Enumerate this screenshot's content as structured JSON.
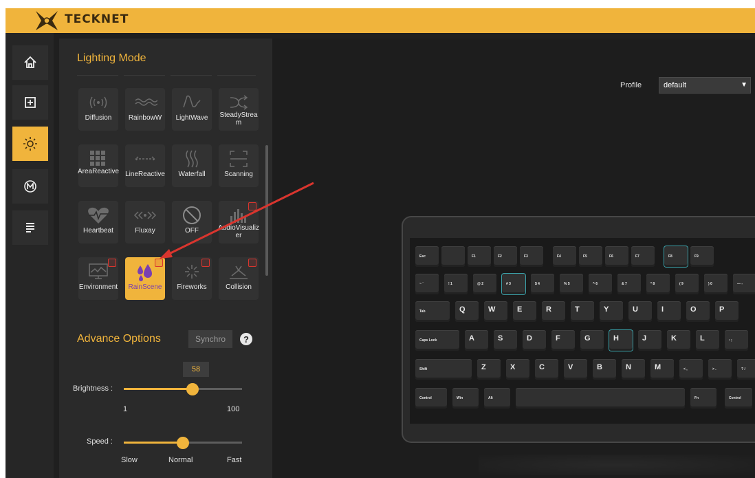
{
  "brand": "TECKNET",
  "rail": {
    "items": [
      {
        "icon": "home-icon",
        "active": false
      },
      {
        "icon": "plus-square-icon",
        "active": false
      },
      {
        "icon": "sun-lighting-icon",
        "active": true
      },
      {
        "icon": "macro-m-icon",
        "active": false
      },
      {
        "icon": "document-lines-icon",
        "active": false
      }
    ]
  },
  "lighting": {
    "title": "Lighting Mode",
    "modes": [
      {
        "label": "Diffusion",
        "icon": "diffusion-icon"
      },
      {
        "label": "RainbowW",
        "icon": "rainbow-wave-icon"
      },
      {
        "label": "LightWave",
        "icon": "light-wave-icon"
      },
      {
        "label": "SteadyStream",
        "icon": "steady-stream-icon"
      },
      {
        "label": "AreaReactive",
        "icon": "area-reactive-icon"
      },
      {
        "label": "LineReactive",
        "icon": "line-reactive-icon"
      },
      {
        "label": "Waterfall",
        "icon": "waterfall-icon"
      },
      {
        "label": "Scanning",
        "icon": "scanning-icon"
      },
      {
        "label": "Heartbeat",
        "icon": "heartbeat-icon"
      },
      {
        "label": "Fluxay",
        "icon": "fluxay-icon"
      },
      {
        "label": "OFF",
        "icon": "off-icon"
      },
      {
        "label": "AudioVisualizer",
        "icon": "audio-visualizer-icon"
      },
      {
        "label": "Environment",
        "icon": "environment-icon"
      },
      {
        "label": "RainScene",
        "icon": "rain-scene-icon",
        "active": true
      },
      {
        "label": "Fireworks",
        "icon": "fireworks-icon"
      },
      {
        "label": "Collision",
        "icon": "collision-icon"
      }
    ]
  },
  "advance": {
    "title": "Advance Options",
    "synchro": "Synchro",
    "help": "?",
    "brightness": {
      "label": "Brightness :",
      "value": "58",
      "min": "1",
      "max": "100",
      "level": 0.58
    },
    "speed": {
      "label": "Speed :",
      "slow": "Slow",
      "normal": "Normal",
      "fast": "Fast",
      "level": 0.5
    }
  },
  "profile": {
    "label": "Profile",
    "value": "default"
  },
  "keyboard": {
    "row0": [
      "Esc",
      "",
      "F1",
      "F2",
      "F3",
      "F4",
      "F5",
      "F6",
      "F7",
      "F8",
      "F9"
    ],
    "row1": [
      "~ `",
      "! 1",
      "@ 2",
      "# 3",
      "$ 4",
      "% 5",
      "^ 6",
      "& 7",
      "* 8",
      "( 9",
      ") 0",
      "— -"
    ],
    "row2": [
      "Tab",
      "Q",
      "W",
      "E",
      "R",
      "T",
      "Y",
      "U",
      "I",
      "O",
      "P",
      "{ ["
    ],
    "row3": [
      "Caps Lock",
      "A",
      "S",
      "D",
      "F",
      "G",
      "H",
      "J",
      "K",
      "L",
      ": ;",
      "\" '"
    ],
    "row4": [
      "Shift",
      "Z",
      "X",
      "C",
      "V",
      "B",
      "N",
      "M",
      "< ,",
      "> .",
      "? /"
    ],
    "row5": [
      "Control",
      "Win",
      "Alt",
      "",
      "Fn",
      "Control"
    ]
  },
  "colors": {
    "accent": "#f0b43c",
    "panel": "#2a2a2a",
    "background": "#1d1d1d",
    "active_label": "#7a3fb0",
    "badge": "#d9352e",
    "arrow": "#d9352e"
  }
}
